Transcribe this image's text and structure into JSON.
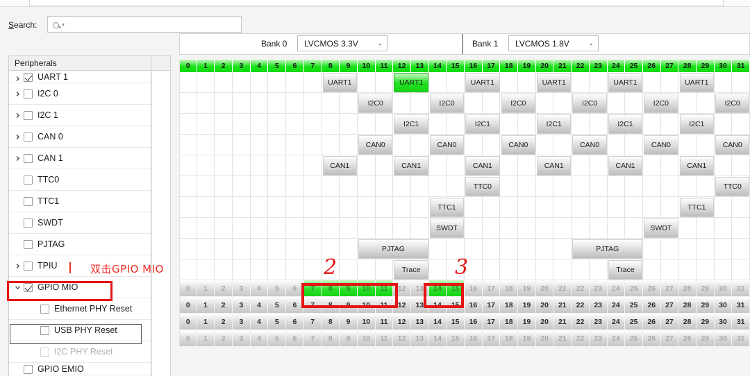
{
  "search": {
    "label": "Search:",
    "value": "",
    "placeholder": "",
    "icon": "search-icon",
    "caret": "▾"
  },
  "tree": {
    "header": "Peripherals",
    "items": [
      {
        "label": "UART 1",
        "arrow": "›",
        "checkbox": "checked",
        "indent": 0,
        "partial": true
      },
      {
        "label": "I2C 0",
        "arrow": "›",
        "checkbox": "unchecked",
        "indent": 0
      },
      {
        "label": "I2C 1",
        "arrow": "›",
        "checkbox": "unchecked",
        "indent": 0
      },
      {
        "label": "CAN 0",
        "arrow": "›",
        "checkbox": "unchecked",
        "indent": 0
      },
      {
        "label": "CAN 1",
        "arrow": "›",
        "checkbox": "unchecked",
        "indent": 0
      },
      {
        "label": "TTC0",
        "arrow": "",
        "checkbox": "unchecked",
        "indent": 0
      },
      {
        "label": "TTC1",
        "arrow": "",
        "checkbox": "unchecked",
        "indent": 0
      },
      {
        "label": "SWDT",
        "arrow": "",
        "checkbox": "unchecked",
        "indent": 0
      },
      {
        "label": "PJTAG",
        "arrow": "",
        "checkbox": "unchecked",
        "indent": 0
      },
      {
        "label": "TPIU",
        "arrow": "›",
        "checkbox": "unchecked",
        "indent": 0
      },
      {
        "label": "GPIO MIO",
        "arrow": "⌄",
        "checkbox": "checked",
        "indent": 0,
        "selected": true
      },
      {
        "label": "Ethernet PHY Reset",
        "arrow": "",
        "checkbox": "unchecked",
        "indent": 1
      },
      {
        "label": "USB PHY Reset",
        "arrow": "",
        "checkbox": "unchecked",
        "indent": 1,
        "focused": true
      },
      {
        "label": "I2C PHY Reset",
        "arrow": "",
        "checkbox": "unchecked",
        "indent": 1,
        "dim": true
      },
      {
        "label": "GPIO EMIO",
        "arrow": "",
        "checkbox": "unchecked",
        "indent": 0,
        "partial": true
      }
    ]
  },
  "banks": [
    {
      "name": "Bank 0",
      "voltage": "LVCMOS 3.3V",
      "caret": "⌄"
    },
    {
      "name": "Bank 1",
      "voltage": "LVCMOS 1.8V",
      "caret": "⌄"
    }
  ],
  "matrix": {
    "columns": [
      0,
      1,
      2,
      3,
      4,
      5,
      6,
      7,
      8,
      9,
      10,
      11,
      12,
      13,
      14,
      15,
      16,
      17,
      18,
      19,
      20,
      21,
      22,
      23,
      24,
      25,
      26,
      27,
      28,
      29,
      30,
      31
    ],
    "peripheral_rows": [
      {
        "name": "UART1",
        "blocks": [
          {
            "label": "UART1",
            "start": 8,
            "span": 2,
            "state": "inactive"
          },
          {
            "label": "UART1",
            "start": 12,
            "span": 2,
            "state": "active"
          },
          {
            "label": "UART1",
            "start": 16,
            "span": 2,
            "state": "inactive"
          },
          {
            "label": "UART1",
            "start": 20,
            "span": 2,
            "state": "inactive"
          },
          {
            "label": "UART1",
            "start": 24,
            "span": 2,
            "state": "inactive"
          },
          {
            "label": "UART1",
            "start": 28,
            "span": 2,
            "state": "inactive"
          }
        ]
      },
      {
        "name": "I2C0",
        "blocks": [
          {
            "label": "I2C0",
            "start": 10,
            "span": 2,
            "state": "inactive"
          },
          {
            "label": "I2C0",
            "start": 14,
            "span": 2,
            "state": "inactive"
          },
          {
            "label": "I2C0",
            "start": 18,
            "span": 2,
            "state": "inactive"
          },
          {
            "label": "I2C0",
            "start": 22,
            "span": 2,
            "state": "inactive"
          },
          {
            "label": "I2C0",
            "start": 26,
            "span": 2,
            "state": "inactive"
          },
          {
            "label": "I2C0",
            "start": 30,
            "span": 2,
            "state": "inactive"
          }
        ]
      },
      {
        "name": "I2C1",
        "blocks": [
          {
            "label": "I2C1",
            "start": 12,
            "span": 2,
            "state": "inactive"
          },
          {
            "label": "I2C1",
            "start": 16,
            "span": 2,
            "state": "inactive"
          },
          {
            "label": "I2C1",
            "start": 20,
            "span": 2,
            "state": "inactive"
          },
          {
            "label": "I2C1",
            "start": 24,
            "span": 2,
            "state": "inactive"
          },
          {
            "label": "I2C1",
            "start": 28,
            "span": 2,
            "state": "inactive"
          }
        ]
      },
      {
        "name": "CAN0",
        "blocks": [
          {
            "label": "CAN0",
            "start": 10,
            "span": 2,
            "state": "inactive"
          },
          {
            "label": "CAN0",
            "start": 14,
            "span": 2,
            "state": "inactive"
          },
          {
            "label": "CAN0",
            "start": 18,
            "span": 2,
            "state": "inactive"
          },
          {
            "label": "CAN0",
            "start": 22,
            "span": 2,
            "state": "inactive"
          },
          {
            "label": "CAN0",
            "start": 26,
            "span": 2,
            "state": "inactive"
          },
          {
            "label": "CAN0",
            "start": 30,
            "span": 2,
            "state": "inactive"
          }
        ]
      },
      {
        "name": "CAN1",
        "blocks": [
          {
            "label": "CAN1",
            "start": 8,
            "span": 2,
            "state": "inactive"
          },
          {
            "label": "CAN1",
            "start": 12,
            "span": 2,
            "state": "inactive"
          },
          {
            "label": "CAN1",
            "start": 16,
            "span": 2,
            "state": "inactive"
          },
          {
            "label": "CAN1",
            "start": 20,
            "span": 2,
            "state": "inactive"
          },
          {
            "label": "CAN1",
            "start": 24,
            "span": 2,
            "state": "inactive"
          },
          {
            "label": "CAN1",
            "start": 28,
            "span": 2,
            "state": "inactive"
          }
        ]
      },
      {
        "name": "TTC0",
        "blocks": [
          {
            "label": "TTC0",
            "start": 16,
            "span": 2,
            "state": "inactive"
          },
          {
            "label": "TTC0",
            "start": 30,
            "span": 2,
            "state": "inactive"
          }
        ]
      },
      {
        "name": "TTC1",
        "blocks": [
          {
            "label": "TTC1",
            "start": 14,
            "span": 2,
            "state": "inactive"
          },
          {
            "label": "TTC1",
            "start": 28,
            "span": 2,
            "state": "inactive"
          }
        ]
      },
      {
        "name": "SWDT",
        "blocks": [
          {
            "label": "SWDT",
            "start": 14,
            "span": 2,
            "state": "inactive"
          },
          {
            "label": "SWDT",
            "start": 26,
            "span": 2,
            "state": "inactive"
          }
        ]
      },
      {
        "name": "PJTAG",
        "blocks": [
          {
            "label": "PJTAG",
            "start": 10,
            "span": 4,
            "state": "inactive"
          },
          {
            "label": "PJTAG",
            "start": 22,
            "span": 4,
            "state": "inactive"
          }
        ]
      },
      {
        "name": "Trace",
        "blocks": [
          {
            "label": "Trace",
            "start": 12,
            "span": 2,
            "state": "inactive"
          },
          {
            "label": "Trace",
            "start": 24,
            "span": 2,
            "state": "inactive"
          }
        ]
      }
    ],
    "number_rows": [
      {
        "name": "gpio-mio-row",
        "faded": true,
        "green": [
          7,
          8,
          9,
          10,
          11,
          14,
          15
        ]
      },
      {
        "name": "pin-row-1",
        "faded": false,
        "green": []
      },
      {
        "name": "pin-row-2",
        "faded": false,
        "green": []
      },
      {
        "name": "pin-row-3",
        "faded": true,
        "green": []
      }
    ]
  },
  "annotations": {
    "chinese_note": "双击GPIO MIO",
    "marker_2": "2",
    "marker_3": "3",
    "color": "#e61414"
  }
}
